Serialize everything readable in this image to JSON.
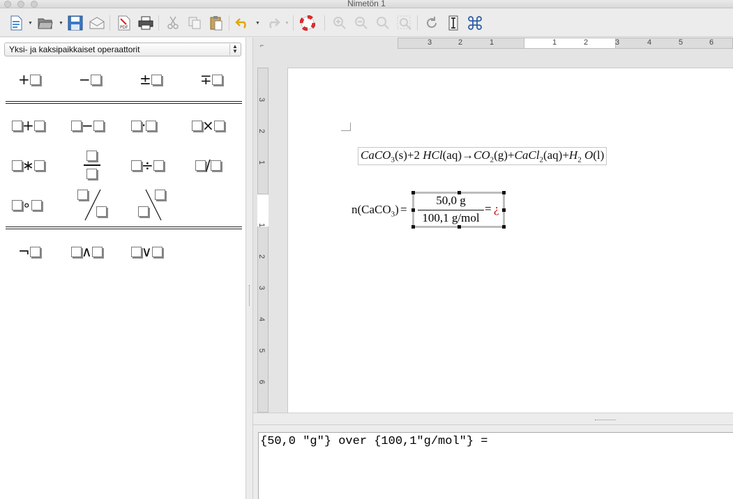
{
  "window": {
    "title": "Nimetön 1"
  },
  "toolbar": {
    "icons": [
      "new-document-icon",
      "open-folder-icon",
      "save-icon",
      "email-icon",
      "export-pdf-icon",
      "print-icon",
      "cut-icon",
      "copy-icon",
      "paste-icon",
      "undo-icon",
      "redo-icon",
      "help-lifebuoy-icon",
      "zoom-in-icon",
      "zoom-out-icon",
      "zoom-100-icon",
      "zoom-fit-icon",
      "refresh-icon",
      "cursor-icon",
      "command-symbols-icon"
    ]
  },
  "elements_panel": {
    "category": "Yksi- ja kaksipaikkaiset operaattorit",
    "unary": [
      "+",
      "−",
      "±",
      "∓"
    ],
    "binary": [
      "+",
      "−",
      "·",
      "×",
      "∗",
      "÷",
      "/",
      "∘"
    ],
    "logic": [
      "¬",
      "∧",
      "∨"
    ]
  },
  "rulers": {
    "horizontal": [
      "3",
      "2",
      "1",
      "1",
      "2",
      "3",
      "4",
      "5",
      "6"
    ],
    "vertical": [
      "3",
      "2",
      "1",
      "1",
      "2",
      "3",
      "4",
      "5",
      "6"
    ]
  },
  "document": {
    "equation": {
      "left": "CaCO",
      "sub1": "3",
      "state1": "(s)",
      "plus1": "+2",
      "hcl": "HCl",
      "state2": "(aq)",
      "arrow": "→",
      "co": "CO",
      "sub2": "2",
      "state3": "(g)",
      "plus2": "+",
      "cacl": "CaCl",
      "sub3": "2",
      "state4": "(aq)",
      "plus3": "+",
      "h": "H",
      "sub4": "2",
      "o": "O",
      "state5": "(l)"
    },
    "moles": {
      "label": "n(CaCO",
      "label_sub": "3",
      "label_close": ")",
      "eq": "=",
      "numerator": "50,0 g",
      "denominator": "100,1 g/mol",
      "eq2": "=",
      "missing": "¿"
    }
  },
  "command_editor": {
    "text": "{50,0 \"g\"} over {100,1\"g/mol\"} ="
  }
}
